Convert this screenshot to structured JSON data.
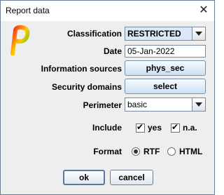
{
  "window": {
    "title": "Report data",
    "close_glyph": "✕"
  },
  "logo": {
    "icon": "p-logo-icon",
    "colors": [
      "#ff1a1a",
      "#ffcc00",
      "#33bb33"
    ]
  },
  "form": {
    "classification": {
      "label": "Classification",
      "value": "RESTRICTED"
    },
    "date": {
      "label": "Date",
      "value": "05-Jan-2022"
    },
    "information_sources": {
      "label": "Information sources",
      "button": "phys_sec"
    },
    "security_domains": {
      "label": "Security domains",
      "button": "select"
    },
    "perimeter": {
      "label": "Perimeter",
      "value": "basic"
    },
    "include": {
      "label": "Include",
      "options": [
        {
          "label": "yes",
          "checked": true
        },
        {
          "label": "n.a.",
          "checked": true
        }
      ]
    },
    "format": {
      "label": "Format",
      "options": [
        {
          "label": "RTF",
          "selected": true
        },
        {
          "label": "HTML",
          "selected": false
        }
      ]
    }
  },
  "buttons": {
    "ok": "ok",
    "cancel": "cancel"
  },
  "colors": {
    "button_top": "#f7fbff",
    "button_bottom": "#cddff3",
    "border": "#7a8a99"
  }
}
